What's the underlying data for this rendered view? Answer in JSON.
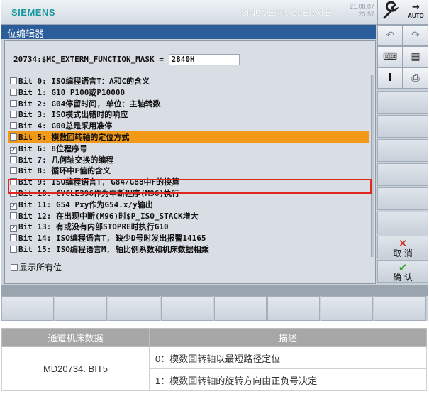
{
  "header": {
    "brand": "SIEMENS",
    "product": "SINUMERIK OPERATE",
    "date": "21.08.07",
    "time": "23:57",
    "auto_label": "AUTO"
  },
  "window": {
    "title": "位编辑器"
  },
  "variable": {
    "name": "20734:$MC_EXTERN_FUNCTION_MASK =",
    "value": "2840H"
  },
  "bits": [
    {
      "label": "Bit 0: ISO编程语言T：A和C的含义",
      "checked": false,
      "selected": false
    },
    {
      "label": "Bit 1: G10 P100或P10000",
      "checked": false,
      "selected": false
    },
    {
      "label": "Bit 2: G04停留时间, 单位：主轴转数",
      "checked": false,
      "selected": false
    },
    {
      "label": "Bit 3: ISO模式出错时的响应",
      "checked": false,
      "selected": false
    },
    {
      "label": "Bit 4: G00总是采用准停",
      "checked": false,
      "selected": false
    },
    {
      "label": "Bit 5: 模数回转轴的定位方式",
      "checked": false,
      "selected": true
    },
    {
      "label": "Bit 6: 8位程序号",
      "checked": true,
      "selected": false
    },
    {
      "label": "Bit 7: 几何轴交换的编程",
      "checked": false,
      "selected": false
    },
    {
      "label": "Bit 8: 循环中F值的含义",
      "checked": false,
      "selected": false
    },
    {
      "label": "Bit 9: ISO编程语言T, G84/G88中F的换算",
      "checked": false,
      "selected": false
    },
    {
      "label": "Bit 10: CYCLE396作为中断程序(M96)执行",
      "checked": false,
      "selected": false
    },
    {
      "label": "Bit 11: G54 Pxy作为G54.x/y输出",
      "checked": true,
      "selected": false
    },
    {
      "label": "Bit 12: 在出现中断(M96)时$P_ISO_STACK增大",
      "checked": false,
      "selected": false
    },
    {
      "label": "Bit 13: 有或没有内部STOPRE时执行G10",
      "checked": true,
      "selected": false
    },
    {
      "label": "Bit 14: ISO编程语言T, 缺少D号时发出报警14165",
      "checked": false,
      "selected": false
    },
    {
      "label": "Bit 15: ISO编程语言M, 轴比例系数和机床数据相乘",
      "checked": false,
      "selected": false
    }
  ],
  "show_all": {
    "label": "显示所有位",
    "checked": false
  },
  "side_buttons": {
    "undo_icon": "undo-icon",
    "redo_icon": "redo-icon",
    "keyboard_icon": "keyboard-icon",
    "calculator_icon": "calculator-icon",
    "info_icon": "info-icon",
    "camera_icon": "camera-icon",
    "cancel_label": "取 消",
    "ok_label": "确 认",
    "cancel_color": "#d9261c",
    "ok_color": "#3aa12b"
  },
  "accent": {
    "selection": "#f29a17",
    "title_bar": "#2b5d9a",
    "highlight_box": "#e0271e"
  },
  "table": {
    "headers": [
      "通道机床数据",
      "描述"
    ],
    "param": "MD20734. BIT5",
    "rows": [
      "0：模数回转轴以最短路径定位",
      "1：模数回转轴的旋转方向由正负号决定"
    ]
  }
}
